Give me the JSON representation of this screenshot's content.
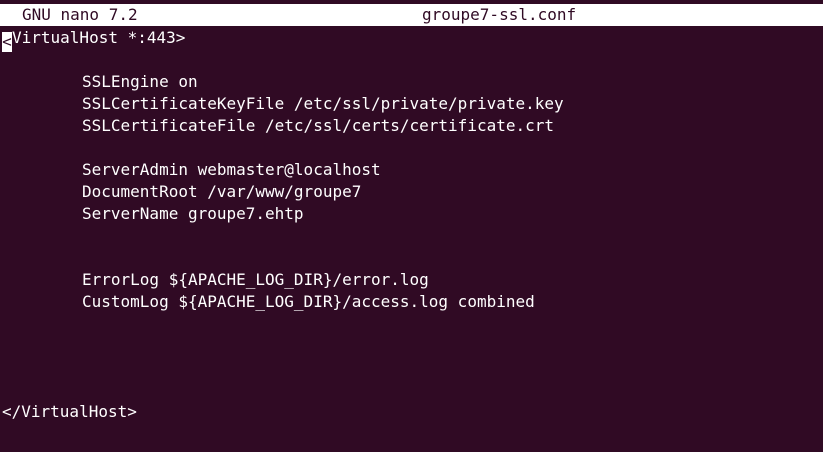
{
  "header": {
    "app_version": "GNU nano 7.2",
    "filename": "groupe7-ssl.conf"
  },
  "editor": {
    "cursor_char": "<",
    "lines": [
      "VirtualHost *:443>",
      "",
      "SSLEngine on",
      "SSLCertificateKeyFile /etc/ssl/private/private.key",
      "SSLCertificateFile /etc/ssl/certs/certificate.crt",
      "",
      "ServerAdmin webmaster@localhost",
      "DocumentRoot /var/www/groupe7",
      "ServerName groupe7.ehtp",
      "",
      "",
      "ErrorLog ${APACHE_LOG_DIR}/error.log",
      "CustomLog ${APACHE_LOG_DIR}/access.log combined",
      "",
      "",
      "",
      "",
      "</VirtualHost>"
    ]
  },
  "colors": {
    "background": "#300a24",
    "foreground": "#ffffff",
    "titlebar_bg": "#ffffff",
    "titlebar_fg": "#300a24"
  }
}
